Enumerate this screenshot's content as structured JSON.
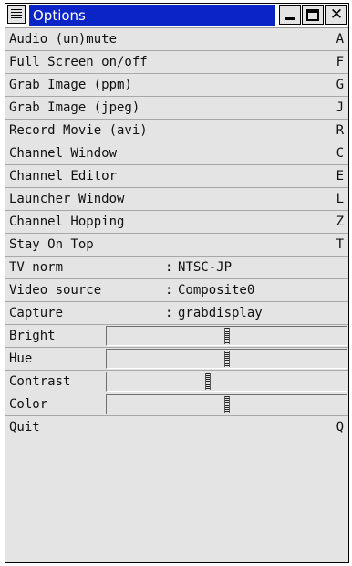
{
  "window": {
    "title": "Options"
  },
  "menu": {
    "items": [
      {
        "label": "Audio (un)mute",
        "key": "A"
      },
      {
        "label": "Full Screen on/off",
        "key": "F"
      },
      {
        "label": "Grab Image (ppm)",
        "key": "G"
      },
      {
        "label": "Grab Image (jpeg)",
        "key": "J"
      },
      {
        "label": "Record Movie (avi)",
        "key": "R"
      },
      {
        "label": "Channel Window",
        "key": "C"
      },
      {
        "label": "Channel Editor",
        "key": "E"
      },
      {
        "label": "Launcher Window",
        "key": "L"
      },
      {
        "label": "Channel Hopping",
        "key": "Z"
      },
      {
        "label": "Stay On Top",
        "key": "T"
      }
    ],
    "settings": [
      {
        "label": "TV norm",
        "value": "NTSC-JP"
      },
      {
        "label": "Video source",
        "value": "Composite0"
      },
      {
        "label": "Capture",
        "value": "grabdisplay"
      }
    ],
    "separator": ":",
    "sliders": [
      {
        "label": "Bright",
        "level": 0.5
      },
      {
        "label": "Hue",
        "level": 0.5
      },
      {
        "label": "Contrast",
        "level": 0.42
      },
      {
        "label": "Color",
        "level": 0.5
      }
    ],
    "quit": {
      "label": "Quit",
      "key": "Q"
    }
  }
}
